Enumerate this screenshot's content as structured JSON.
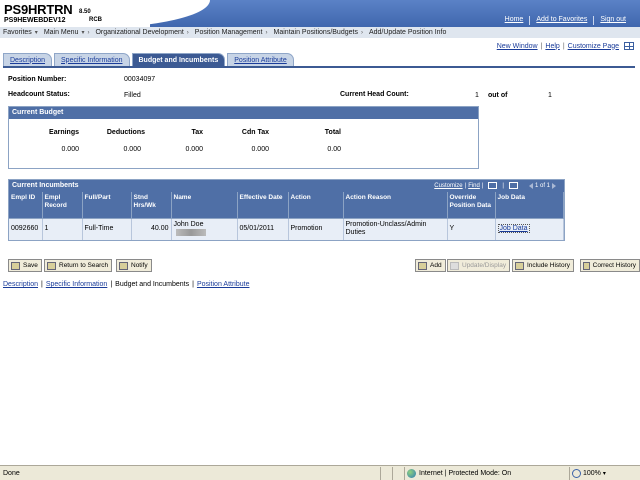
{
  "header": {
    "logo": "PS9HRTRN",
    "version": "8.50",
    "subtitle": "PS9HEWEBDEV12",
    "env_tag": "RCB",
    "links": [
      "Home",
      "Add to Favorites",
      "Sign out"
    ]
  },
  "nav": {
    "items": [
      "Favorites",
      "Main Menu",
      "Organizational Development",
      "Position Management",
      "Maintain Positions/Budgets",
      "Add/Update Position Info"
    ]
  },
  "toplinks": {
    "new_window": "New Window",
    "help": "Help",
    "customize_page": "Customize Page",
    "sep": "|"
  },
  "tabs": [
    {
      "label": "Description",
      "active": false
    },
    {
      "label": "Specific Information",
      "active": false
    },
    {
      "label": "Budget and Incumbents",
      "active": true
    },
    {
      "label": "Position Attribute",
      "active": false
    }
  ],
  "position": {
    "number_label": "Position Number:",
    "number_value": "00034097",
    "headcount_status_label": "Headcount Status:",
    "headcount_status_value": "Filled",
    "current_head_count_label": "Current Head Count:",
    "current_head_count_value": "1",
    "out_of_label": "out of",
    "out_of_value": "1"
  },
  "budget": {
    "title": "Current Budget",
    "columns": [
      {
        "label": "Earnings",
        "value": "0.000"
      },
      {
        "label": "Deductions",
        "value": "0.000"
      },
      {
        "label": "Tax",
        "value": "0.000"
      },
      {
        "label": "Cdn Tax",
        "value": "0.000"
      },
      {
        "label": "Total",
        "value": "0.00"
      }
    ]
  },
  "incumbents": {
    "title": "Current Incumbents",
    "customize": "Customize",
    "find": "Find",
    "first": "First",
    "range": "1 of 1",
    "last": "Last",
    "headers": [
      "Empl ID",
      "Empl Record",
      "Full/Part",
      "Stnd Hrs/Wk",
      "Name",
      "Effective Date",
      "Action",
      "Action Reason",
      "Override Position Data",
      "Job Data"
    ],
    "rows": [
      {
        "empl_id": "0092660",
        "empl_record": "1",
        "full_part": "Full-Time",
        "std_hrs": "40.00",
        "name": "John Doe",
        "effective_date": "05/01/2011",
        "action": "Promotion",
        "action_reason": "Promotion-Unclass/Admin Duties",
        "override": "Y",
        "job_data": "Job Data"
      }
    ]
  },
  "buttons": {
    "save": "Save",
    "return_to_search": "Return to Search",
    "notify": "Notify",
    "add": "Add",
    "update_display": "Update/Display",
    "include_history": "Include History",
    "correct_history": "Correct History"
  },
  "bottom_links": [
    "Description",
    "Specific Information",
    "Budget and Incumbents",
    "Position Attribute"
  ],
  "status_bar": {
    "left": "Done",
    "zone": "Internet | Protected Mode: On",
    "zoom": "100%"
  },
  "colors": {
    "header_blue": "#4f6fa6",
    "tab_active": "#3c5a93",
    "link": "#1a3c9a"
  }
}
